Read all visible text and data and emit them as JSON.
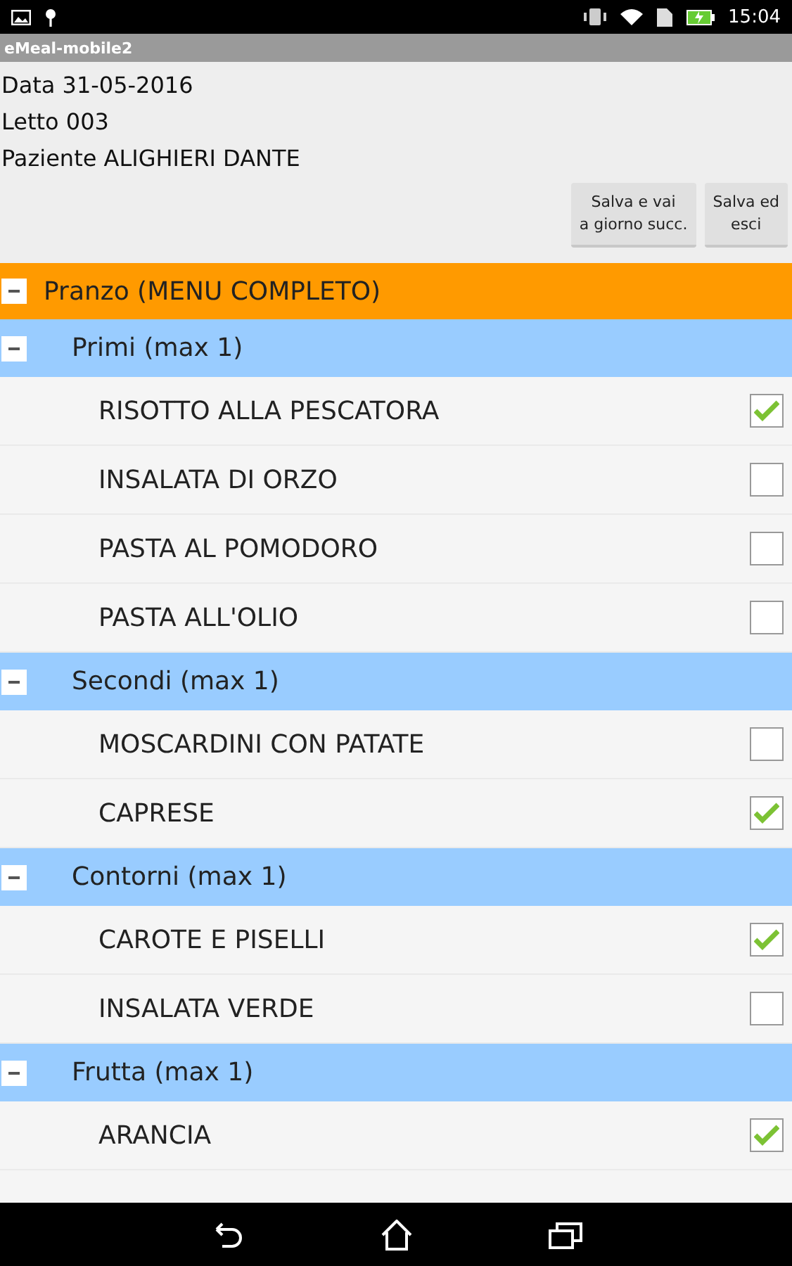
{
  "status_bar": {
    "time": "15:04"
  },
  "window": {
    "title": "eMeal-mobile2"
  },
  "info": [
    "Data 31-05-2016",
    "Letto 003",
    "Paziente ALIGHIERI DANTE"
  ],
  "buttons": [
    {
      "label": "Salva e vai\na giorno succ."
    },
    {
      "label": "Salva ed\nesci"
    }
  ],
  "meal": {
    "title": "Pranzo (MENU COMPLETO)",
    "expanded": true,
    "groups": [
      {
        "title": "Primi (max 1)",
        "expanded": true,
        "items": [
          {
            "label": "RISOTTO ALLA PESCATORA",
            "checked": true
          },
          {
            "label": "INSALATA DI ORZO",
            "checked": false
          },
          {
            "label": "PASTA AL POMODORO",
            "checked": false
          },
          {
            "label": "PASTA ALL'OLIO",
            "checked": false
          }
        ]
      },
      {
        "title": "Secondi (max 1)",
        "expanded": true,
        "items": [
          {
            "label": "MOSCARDINI CON PATATE",
            "checked": false
          },
          {
            "label": "CAPRESE",
            "checked": true
          }
        ]
      },
      {
        "title": "Contorni (max 1)",
        "expanded": true,
        "items": [
          {
            "label": "CAROTE E PISELLI",
            "checked": true
          },
          {
            "label": "INSALATA VERDE",
            "checked": false
          }
        ]
      },
      {
        "title": "Frutta (max 1)",
        "expanded": true,
        "items": [
          {
            "label": "ARANCIA",
            "checked": true
          }
        ]
      }
    ]
  }
}
